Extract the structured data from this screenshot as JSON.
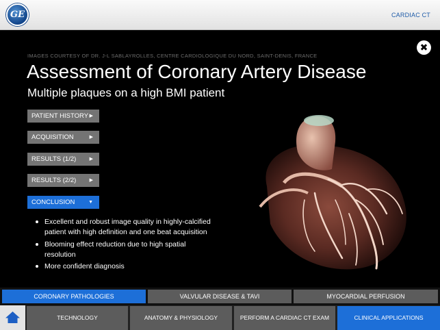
{
  "header": {
    "logo_text": "GE",
    "section_title": "CARDIAC CT"
  },
  "content": {
    "credit": "IMAGES COURTESY OF DR. J-L SABLAYROLLES, CENTRE CARDIOLOGIQUE DU NORD, SAINT-DENIS, FRANCE",
    "title": "Assessment of Coronary Artery Disease",
    "subtitle": "Multiple plaques on a high BMI patient",
    "close_symbol": "✖",
    "accordion": [
      {
        "label": "PATIENT HISTORY",
        "arrow": "▶"
      },
      {
        "label": "ACQUISITION",
        "arrow": "▶"
      },
      {
        "label": "RESULTS (1/2)",
        "arrow": "▶"
      },
      {
        "label": "RESULTS (2/2)",
        "arrow": "▶"
      },
      {
        "label": "CONCLUSION",
        "arrow": "▼"
      }
    ],
    "conclusion_bullets": [
      "Excellent and robust image quality in highly-calcified patient with high definition and one beat acquisition",
      "Blooming effect reduction due to high spatial resolution",
      "More confident diagnosis"
    ]
  },
  "tabs": [
    {
      "label": "CORONARY PATHOLOGIES"
    },
    {
      "label": "VALVULAR DISEASE & TAVI"
    },
    {
      "label": "MYOCARDIAL PERFUSION"
    }
  ],
  "bottom_nav": [
    {
      "label": "TECHNOLOGY"
    },
    {
      "label": "ANATOMY & PHYSIOLOGY"
    },
    {
      "label": "PERFORM A CARDIAC CT EXAM"
    },
    {
      "label": "CLINICAL APPLICATIONS"
    }
  ],
  "colors": {
    "accent": "#1d6fd8",
    "inactive": "#5c5c5c",
    "brand": "#1e5ba8"
  },
  "icons": {
    "home": "home-icon",
    "close": "close-icon",
    "logo": "ge-logo"
  }
}
